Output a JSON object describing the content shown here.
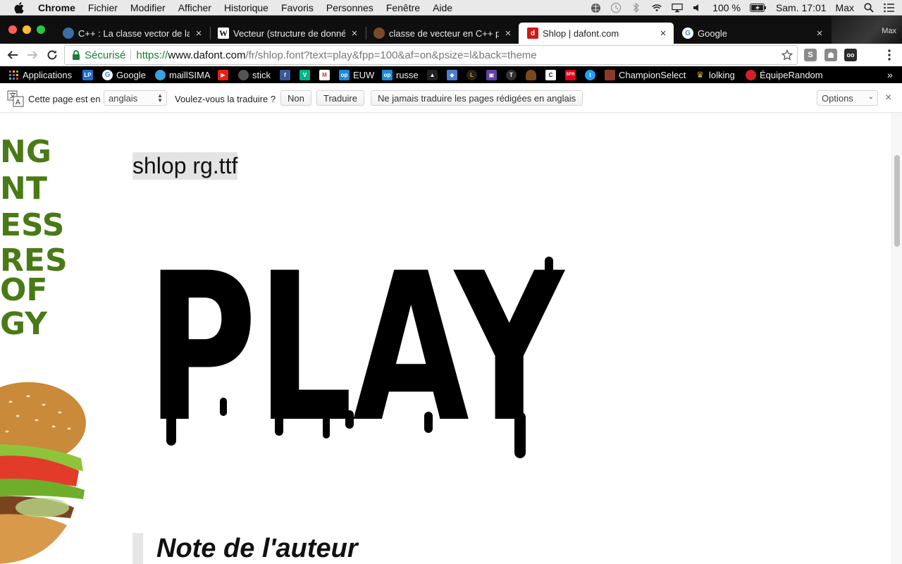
{
  "menubar": {
    "app": "Chrome",
    "items": [
      "Fichier",
      "Modifier",
      "Afficher",
      "Historique",
      "Favoris",
      "Personnes",
      "Fenêtre",
      "Aide"
    ],
    "battery": "100 %",
    "clock": "Sam. 17:01",
    "user": "Max"
  },
  "tabs": [
    {
      "title": "C++ : La classe vector de la l",
      "favicon": "globe-icon",
      "active": false
    },
    {
      "title": "Vecteur (structure de donnée",
      "favicon": "wikipedia-icon",
      "active": false
    },
    {
      "title": "classe de vecteur en C++ par",
      "favicon": "openclassrooms-icon",
      "active": false
    },
    {
      "title": "Shlop | dafont.com",
      "favicon": "dafont-icon",
      "active": true
    },
    {
      "title": "Google",
      "favicon": "google-icon",
      "active": false
    }
  ],
  "profile": {
    "name": "Max"
  },
  "omnibox": {
    "secure_label": "Sécurisé",
    "scheme": "https://",
    "host": "www.dafont.com",
    "path": "/fr/shlop.font?text=play&fpp=100&af=on&psize=l&back=theme"
  },
  "bookmarks": [
    {
      "label": "Applications",
      "icon": "apps-grid-icon"
    },
    {
      "label": "",
      "icon": "blue-square-icon"
    },
    {
      "label": "Google",
      "icon": "google-icon"
    },
    {
      "label": "maillSIMA",
      "icon": "mail-icon"
    },
    {
      "label": "",
      "icon": "youtube-icon"
    },
    {
      "label": "stick",
      "icon": "stick-icon"
    },
    {
      "label": "",
      "icon": "facebook-icon"
    },
    {
      "label": "",
      "icon": "vine-icon"
    },
    {
      "label": "",
      "icon": "gmail-icon"
    },
    {
      "label": "EUW",
      "icon": "opgg-icon"
    },
    {
      "label": "russe",
      "icon": "opgg-icon"
    },
    {
      "label": "",
      "icon": "skill-icon"
    },
    {
      "label": "",
      "icon": "shield-icon"
    },
    {
      "label": "",
      "icon": "league-icon"
    },
    {
      "label": "",
      "icon": "twitch-icon"
    },
    {
      "label": "",
      "icon": "tezos-icon"
    },
    {
      "label": "",
      "icon": "poop-icon"
    },
    {
      "label": "",
      "icon": "c-icon"
    },
    {
      "label": "",
      "icon": "sfr-icon"
    },
    {
      "label": "",
      "icon": "twitter-icon"
    },
    {
      "label": "ChampionSelect",
      "icon": "champion-icon"
    },
    {
      "label": "lolking",
      "icon": "crown-icon"
    },
    {
      "label": "ÉquipeRandom",
      "icon": "random-icon"
    }
  ],
  "translate": {
    "prefix": "Cette page est en",
    "language": "anglais",
    "question": "Voulez-vous la traduire ?",
    "no": "Non",
    "translate": "Traduire",
    "never": "Ne jamais traduire les pages rédigées en anglais",
    "options": "Options"
  },
  "page": {
    "font_file": "shlop rg.ttf",
    "preview_text": "PLAY",
    "note_heading": "Note de l'auteur",
    "side_art_text": [
      "NG",
      "NT",
      "ESS",
      "RES",
      "OF",
      "GY"
    ]
  },
  "colors": {
    "secure": "#188038",
    "bookmarks_bg": "#000000",
    "tabstrip_bg": "#0f0f0f",
    "side_art_green": "#4a7a16"
  }
}
